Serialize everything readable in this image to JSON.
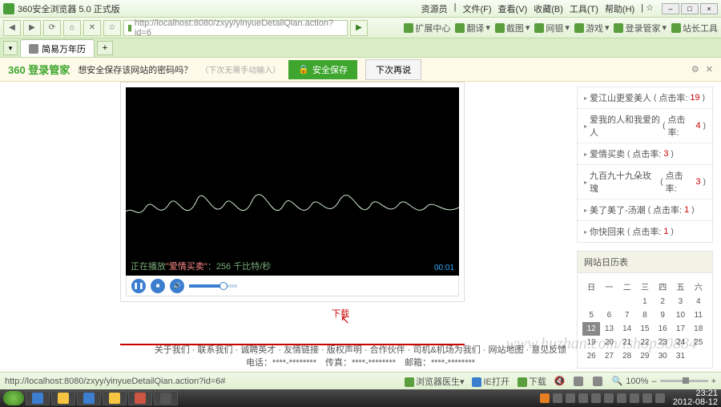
{
  "window": {
    "title": "360安全浏览器 5.0 正式版",
    "menu": [
      "资源员",
      "文件(F)",
      "查看(V)",
      "收藏(B)",
      "工具(T)",
      "帮助(H)"
    ],
    "url": "http://localhost:8080/zxyy/yinyueDetailQian.action?id=6",
    "tab_label": "简易万年历",
    "toolbar_right": [
      "扩展中心",
      "翻译",
      "截图",
      "网银",
      "游戏",
      "登录管家",
      "站长工具"
    ]
  },
  "savebar": {
    "logo": "360 登录管家",
    "prompt": "想安全保存该网站的密码吗？",
    "hint": "（下次无需手动输入）",
    "save": "安全保存",
    "later": "下次再说"
  },
  "player": {
    "status_prefix": "正在播放",
    "song": "\"爱情买卖\"",
    "bitrate": "：256 千比特/秒",
    "time": "00:01",
    "download": "下载"
  },
  "songs": [
    {
      "title": "爱江山更爱美人",
      "label": "点击率:",
      "rate": "19"
    },
    {
      "title": "爱我的人和我爱的人",
      "label": "点击率:",
      "rate": "4"
    },
    {
      "title": "爱情买卖",
      "label": "点击率:",
      "rate": "3"
    },
    {
      "title": "九百九十九朵玫瑰",
      "label": "点击率:",
      "rate": "3"
    },
    {
      "title": "美了美了-汤潮",
      "label": "点击率:",
      "rate": "1"
    },
    {
      "title": "你快回来",
      "label": "点击率:",
      "rate": "1"
    }
  ],
  "calendar": {
    "title": "网站日历表",
    "weekdays": [
      "日",
      "一",
      "二",
      "三",
      "四",
      "五",
      "六"
    ],
    "today": 12,
    "days": [
      "",
      "",
      "",
      "1",
      "2",
      "3",
      "4",
      "5",
      "6",
      "7",
      "8",
      "9",
      "10",
      "11",
      "12",
      "13",
      "14",
      "15",
      "16",
      "17",
      "18",
      "19",
      "20",
      "21",
      "22",
      "23",
      "24",
      "25",
      "26",
      "27",
      "28",
      "29",
      "30",
      "31"
    ]
  },
  "footer": {
    "line1": "关于我们 · 联系我们 · 诚聘英才 · 友情链接 · 版权声明 · 合作伙伴 · 司机&机场为我们 · 网站地图 · 意见反馈",
    "line2": "电话：****-********　传真：****-********　邮箱：****-********",
    "watermark": "www.huzhan.com/ishop30884"
  },
  "statusbar": {
    "url": "http://localhost:8080/zxyy/yinyueDetailQian.action?id=6#",
    "items": [
      "浏览器医生",
      "IE打开",
      "下载",
      "Q",
      "电脑",
      "100%"
    ]
  },
  "taskbar": {
    "time": "23:21",
    "date": "2012-08-12"
  }
}
